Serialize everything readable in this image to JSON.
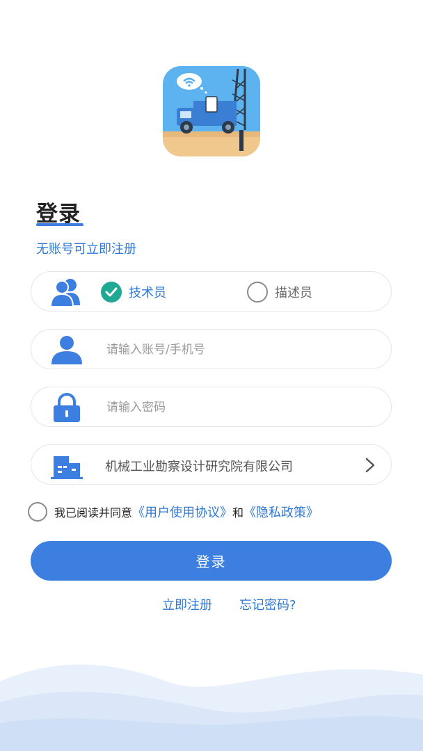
{
  "page": {
    "title": "登录",
    "register_prompt": "无账号可立即注册"
  },
  "role_selector": {
    "options": [
      {
        "label": "技术员",
        "selected": true
      },
      {
        "label": "描述员",
        "selected": false
      }
    ],
    "selected_color": "#1fa894"
  },
  "account_field": {
    "value": "",
    "placeholder": "请输入账号/手机号"
  },
  "password_field": {
    "value": "",
    "placeholder": "请输入密码"
  },
  "company_selector": {
    "value": "机械工业勘察设计研究院有限公司"
  },
  "agreement": {
    "checked": false,
    "prefix": "我已阅读并同意",
    "user_agreement": "《用户使用协议》",
    "conjunction": "和",
    "privacy_policy": "《隐私政策》"
  },
  "login_button": {
    "label": "登录"
  },
  "bottom_links": {
    "register": "立即注册",
    "forgot_password": "忘记密码?"
  },
  "colors": {
    "accent": "#3d7fe0",
    "link": "#2f78d6",
    "icon": "#3d7fe0",
    "check": "#1fa894"
  },
  "icons": [
    "app-logo",
    "users-icon",
    "check-circle-icon",
    "radio-empty-icon",
    "user-icon",
    "lock-icon",
    "building-icon",
    "chevron-right-icon"
  ]
}
